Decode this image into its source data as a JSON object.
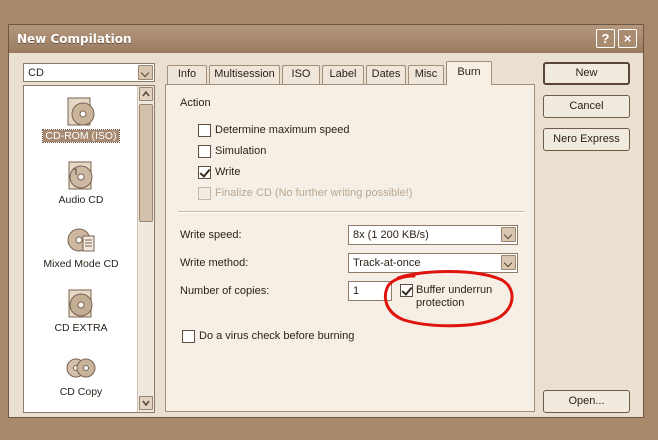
{
  "window": {
    "title": "New Compilation"
  },
  "titlebar": {
    "help_label": "?",
    "close_label": "×"
  },
  "disc_type": {
    "selected": "CD"
  },
  "compilation_types": [
    {
      "label": "CD-ROM (ISO)",
      "icon": "cd-rom-iso-icon",
      "selected": true
    },
    {
      "label": "Audio CD",
      "icon": "audio-cd-icon"
    },
    {
      "label": "Mixed Mode CD",
      "icon": "mixed-mode-cd-icon"
    },
    {
      "label": "CD EXTRA",
      "icon": "cd-extra-icon"
    },
    {
      "label": "CD Copy",
      "icon": "cd-copy-icon"
    }
  ],
  "tabs": [
    {
      "label": "Info"
    },
    {
      "label": "Multisession"
    },
    {
      "label": "ISO"
    },
    {
      "label": "Label"
    },
    {
      "label": "Dates"
    },
    {
      "label": "Misc"
    },
    {
      "label": "Burn",
      "active": true
    }
  ],
  "burn": {
    "action_header": "Action",
    "determine_speed": {
      "label": "Determine maximum speed",
      "checked": false
    },
    "simulation": {
      "label": "Simulation",
      "checked": false
    },
    "write": {
      "label": "Write",
      "checked": true
    },
    "finalize": {
      "label": "Finalize CD (No further writing possible!)",
      "checked": false,
      "disabled": true
    },
    "write_speed": {
      "label": "Write speed:",
      "value": "8x (1 200 KB/s)"
    },
    "write_method": {
      "label": "Write method:",
      "value": "Track-at-once"
    },
    "copies": {
      "label": "Number of copies:",
      "value": "1"
    },
    "buffer_underrun": {
      "label_line1": "Buffer underrun",
      "label_line2": "protection",
      "checked": true
    },
    "virus_check": {
      "label": "Do a virus check before burning",
      "checked": false
    }
  },
  "buttons": {
    "new": "New",
    "cancel": "Cancel",
    "nero_express": "Nero Express",
    "open": "Open..."
  },
  "annotation": {
    "color": "#e0140e"
  }
}
